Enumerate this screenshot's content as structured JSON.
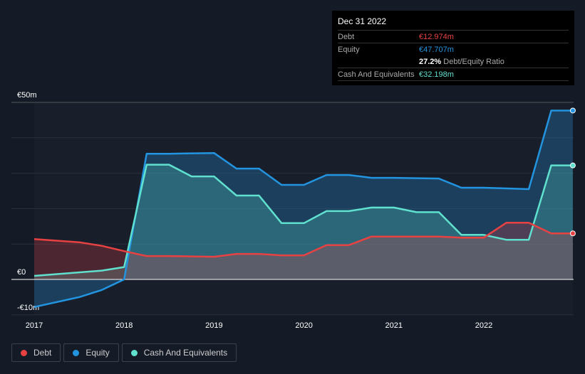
{
  "tooltip": {
    "date": "Dec 31 2022",
    "debt_label": "Debt",
    "debt_value": "€12.974m",
    "equity_label": "Equity",
    "equity_value": "€47.707m",
    "ratio_value": "27.2%",
    "ratio_label": "Debt/Equity Ratio",
    "cash_label": "Cash And Equivalents",
    "cash_value": "€32.198m"
  },
  "legend": [
    {
      "label": "Debt",
      "color": "#e84142"
    },
    {
      "label": "Equity",
      "color": "#2394df"
    },
    {
      "label": "Cash And Equivalents",
      "color": "#60e1cf"
    }
  ],
  "chart_data": {
    "type": "area",
    "ylim": [
      -10,
      50
    ],
    "xlim": [
      2017,
      2023
    ],
    "y_ticks": [
      {
        "v": 50,
        "label": "€50m"
      },
      {
        "v": 0,
        "label": "€0"
      },
      {
        "v": -10,
        "label": "-€10m"
      }
    ],
    "x_ticks": [
      "2017",
      "2018",
      "2019",
      "2020",
      "2021",
      "2022"
    ],
    "grid": true,
    "series": [
      {
        "name": "Equity",
        "color": "#2394df",
        "x": [
          2017,
          2017.5,
          2017.75,
          2018,
          2018.25,
          2018.5,
          2019,
          2019.25,
          2019.5,
          2019.75,
          2020,
          2020.25,
          2020.5,
          2020.75,
          2021,
          2021.5,
          2021.75,
          2022,
          2022.5,
          2022.75,
          2022.99
        ],
        "y": [
          -7.8,
          -5,
          -3,
          0,
          35.5,
          35.5,
          35.7,
          31.3,
          31.3,
          26.7,
          26.7,
          29.5,
          29.5,
          28.7,
          28.7,
          28.5,
          25.9,
          25.9,
          25.5,
          47.7,
          47.7
        ]
      },
      {
        "name": "Cash And Equivalents",
        "color": "#60e1cf",
        "x": [
          2017,
          2017.75,
          2018,
          2018.25,
          2018.5,
          2018.75,
          2019,
          2019.25,
          2019.5,
          2019.75,
          2020,
          2020.25,
          2020.5,
          2020.75,
          2021,
          2021.25,
          2021.5,
          2021.75,
          2022,
          2022.25,
          2022.5,
          2022.75,
          2022.99
        ],
        "y": [
          1,
          2.5,
          3.5,
          32.4,
          32.4,
          29.1,
          29.1,
          23.7,
          23.7,
          15.9,
          15.9,
          19.3,
          19.3,
          20.3,
          20.3,
          19,
          19,
          12.6,
          12.6,
          11.2,
          11.2,
          32.2,
          32.2
        ]
      },
      {
        "name": "Debt",
        "color": "#e84142",
        "x": [
          2017,
          2017.5,
          2017.75,
          2018,
          2018.25,
          2018.5,
          2019,
          2019.25,
          2019.5,
          2019.75,
          2020,
          2020.25,
          2020.5,
          2020.75,
          2021,
          2021.5,
          2021.75,
          2022,
          2022.25,
          2022.5,
          2022.75,
          2022.99
        ],
        "y": [
          11.4,
          10.5,
          9.5,
          8,
          6.6,
          6.6,
          6.4,
          7.2,
          7.2,
          6.8,
          6.8,
          9.7,
          9.7,
          12.1,
          12.1,
          12.1,
          11.8,
          11.8,
          16,
          16,
          13,
          13
        ]
      }
    ]
  }
}
